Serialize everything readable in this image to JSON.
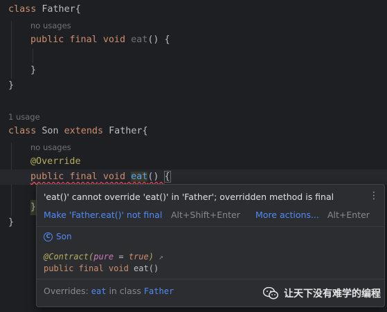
{
  "editor": {
    "lines": {
      "l1": {
        "kw": "class",
        "rest": " Father{"
      },
      "l1_usages": "no usages",
      "l2": {
        "kw1": "public",
        "kw2": "final",
        "kw3": "void",
        "name": "eat",
        "rest": "() {"
      },
      "l3": "}",
      "l4": "}",
      "son_usages": "1 usage",
      "l5": {
        "kw": "class",
        "name": " Son ",
        "kw2": "extends",
        "rest": " Father{"
      },
      "l5_usages": "no usages",
      "l6": "@Override",
      "l7": {
        "kw1": "public",
        "kw2": "final",
        "kw3": "void",
        "name": "eat",
        "paren": "() ",
        "brace": "{"
      },
      "l8": "}",
      "l9": "}"
    }
  },
  "popup": {
    "message": "'eat()' cannot override 'eat()' in 'Father'; overridden method is final",
    "quickfix_label": "Make 'Father.eat()' not final",
    "quickfix_shortcut": "Alt+Shift+Enter",
    "more_label": "More actions...",
    "more_shortcut": "Alt+Enter",
    "doc_class_icon": "C",
    "doc_class_name": "Son",
    "doc_annotation": "@Contract(",
    "doc_ann_param": "pure",
    "doc_ann_eq": " = ",
    "doc_ann_value": "true",
    "doc_ann_close": ")",
    "doc_ann_arrow": "↗",
    "doc_sig_kw": "public final void",
    "doc_sig_name": " eat()",
    "overrides_prefix": "Overrides: ",
    "overrides_method": "eat",
    "overrides_mid": " in class ",
    "overrides_class": "Father",
    "kebab": "⋮"
  },
  "watermark": {
    "text": "让天下没有难学的编程"
  },
  "colors": {
    "keyword": "#cf8e6d",
    "link": "#548af7",
    "annotation": "#b3ae60",
    "error": "#f75464"
  }
}
